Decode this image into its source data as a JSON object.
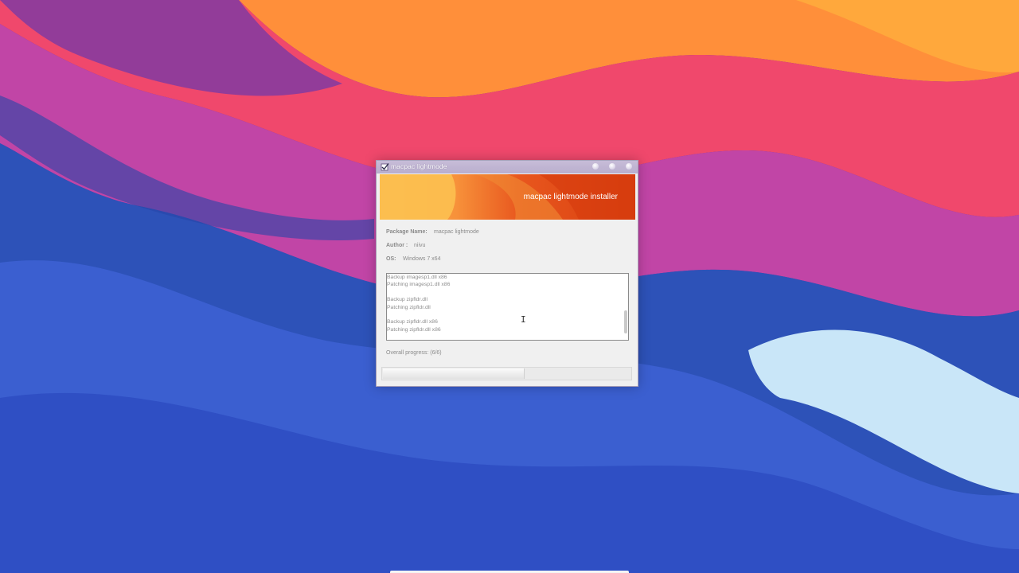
{
  "window": {
    "title": "macpac lightmode",
    "banner_title": "macpac lightmode installer"
  },
  "info": {
    "package_label": "Package Name:",
    "package_value": "macpac lightmode",
    "author_label": "Author :",
    "author_value": "niivu",
    "os_label": "OS:",
    "os_value": "Windows 7 x64"
  },
  "log": {
    "lines": [
      "Backup imagesp1.dll x86",
      "Patching imagesp1.dll x86",
      "",
      "Backup zipfldr.dll",
      "Patching zipfldr.dll",
      "",
      "Backup zipfldr.dll x86",
      "Patching zipfldr.dll x86"
    ]
  },
  "progress": {
    "label": "Overall progress:",
    "count": "(6/6)",
    "fraction": 0.57
  },
  "icons": {
    "app": "installer-check-icon",
    "minimize": "minimize-icon",
    "maximize": "maximize-icon",
    "close": "close-icon",
    "cursor": "text-cursor-icon"
  },
  "colors": {
    "banner_start": "#fbb24a",
    "banner_end": "#d8400f",
    "titlebar": "#c7bcd8"
  }
}
